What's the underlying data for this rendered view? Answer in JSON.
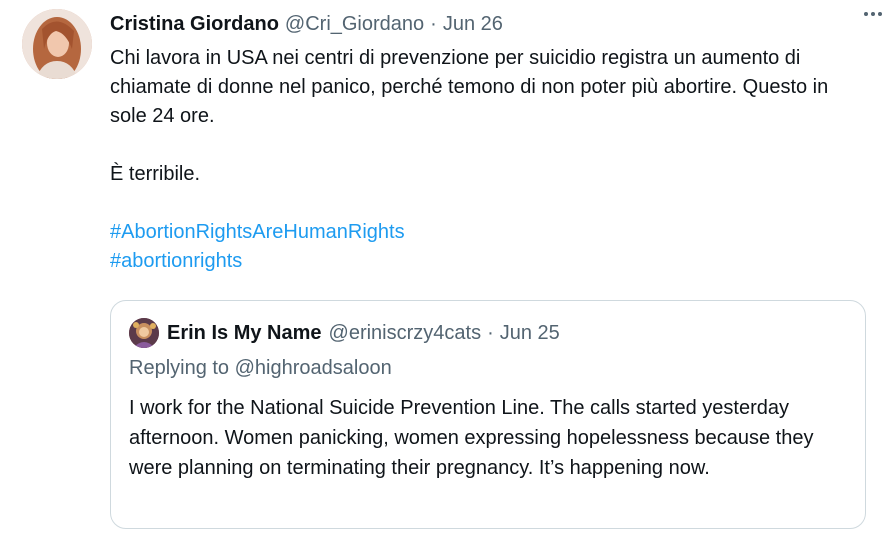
{
  "tweet": {
    "author_name": "Cristina Giordano",
    "author_handle": "@Cri_Giordano",
    "separator": "·",
    "date": "Jun 26",
    "avatar_icon": "user-avatar-photo",
    "more_icon": "more-options-icon",
    "text_paragraph_1": "Chi lavora in USA nei centri di prevenzione per suicidio registra un aumento di chiamate di donne nel panico, perché temono di non poter più abortire. Questo in sole 24 ore.",
    "text_paragraph_2": "È terribile.",
    "hashtags": [
      "#AbortionRightsAreHumanRights",
      "#abortionrights"
    ]
  },
  "quoted_tweet": {
    "author_name": "Erin Is My Name",
    "author_handle": "@eriniscrzy4cats",
    "separator": "·",
    "date": "Jun 25",
    "replying_to": "Replying to @highroadsaloon",
    "text": "I work for the National Suicide Prevention Line. The calls started yesterday afternoon. Women panicking, women expressing hopelessness because they were planning on terminating their pregnancy. It’s happening now."
  },
  "colors": {
    "text": "#0f1419",
    "secondary": "#536471",
    "link": "#1d9bf0",
    "border": "#cfd9de"
  }
}
